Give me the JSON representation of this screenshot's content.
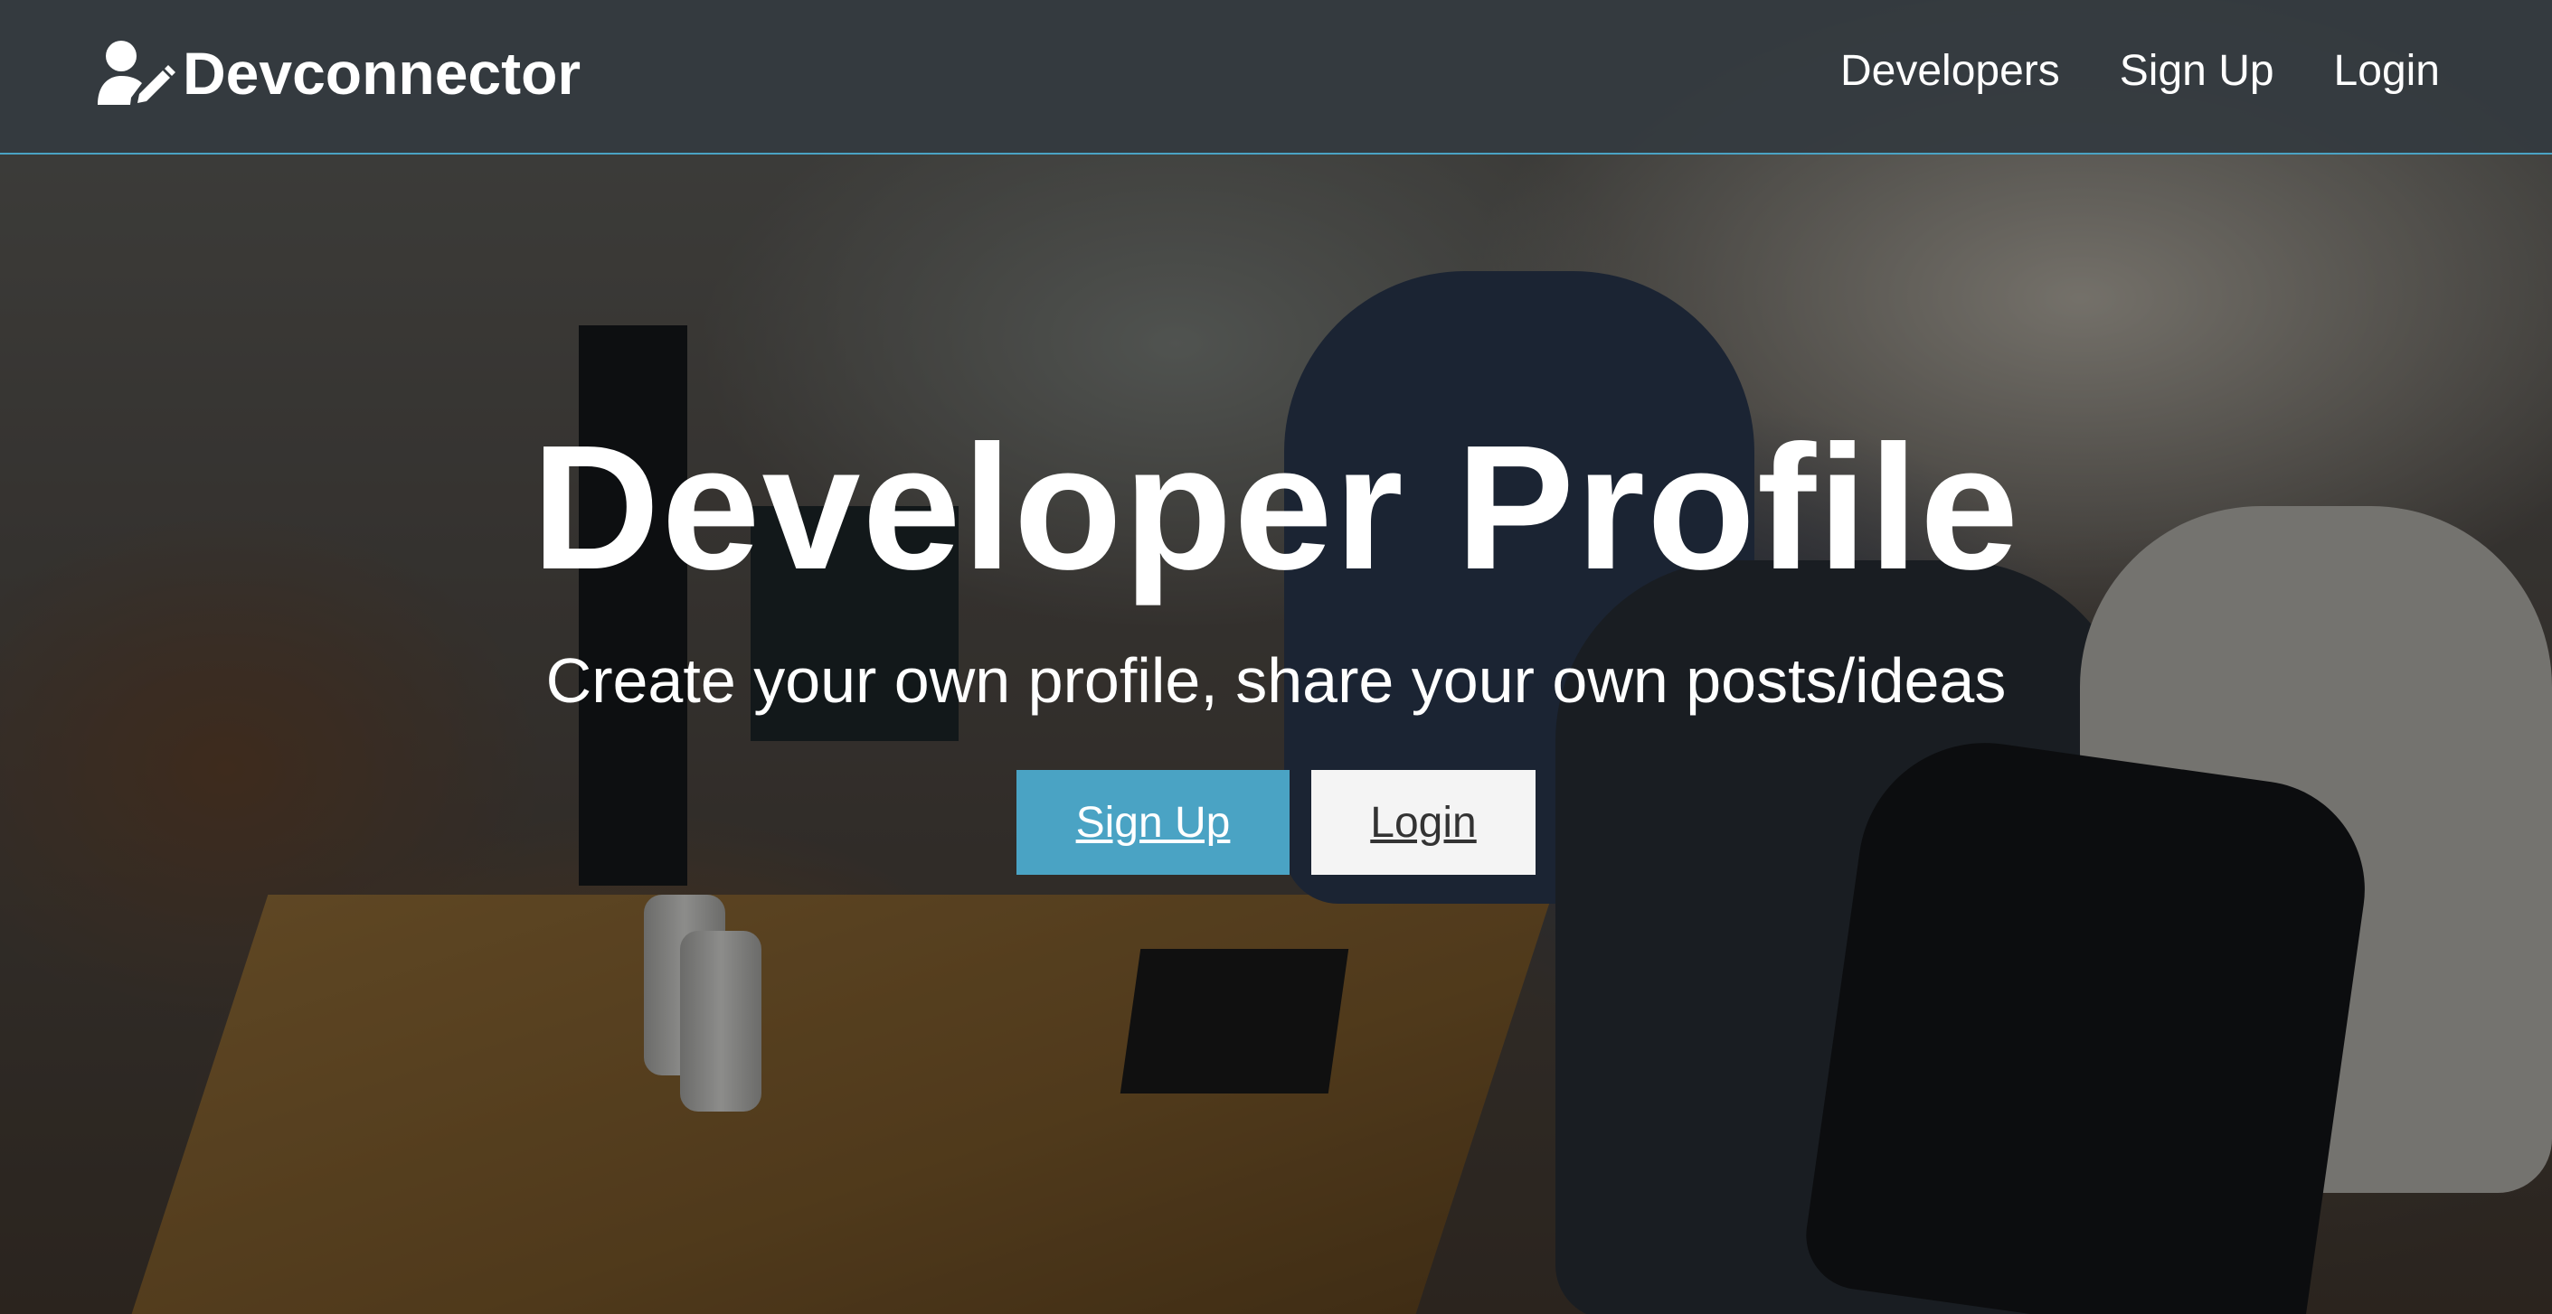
{
  "navbar": {
    "brand_icon": "user-code-icon",
    "brand": "Devconnector",
    "links": [
      {
        "label": "Developers"
      },
      {
        "label": "Sign Up"
      },
      {
        "label": "Login"
      }
    ]
  },
  "hero": {
    "title": "Developer Profile",
    "subtitle": "Create your own profile, share your own posts/ideas",
    "signup_label": "Sign Up",
    "login_label": "Login"
  },
  "colors": {
    "accent": "#4aa3c4",
    "navbar": "#343a40",
    "light_button": "#f4f4f4"
  }
}
